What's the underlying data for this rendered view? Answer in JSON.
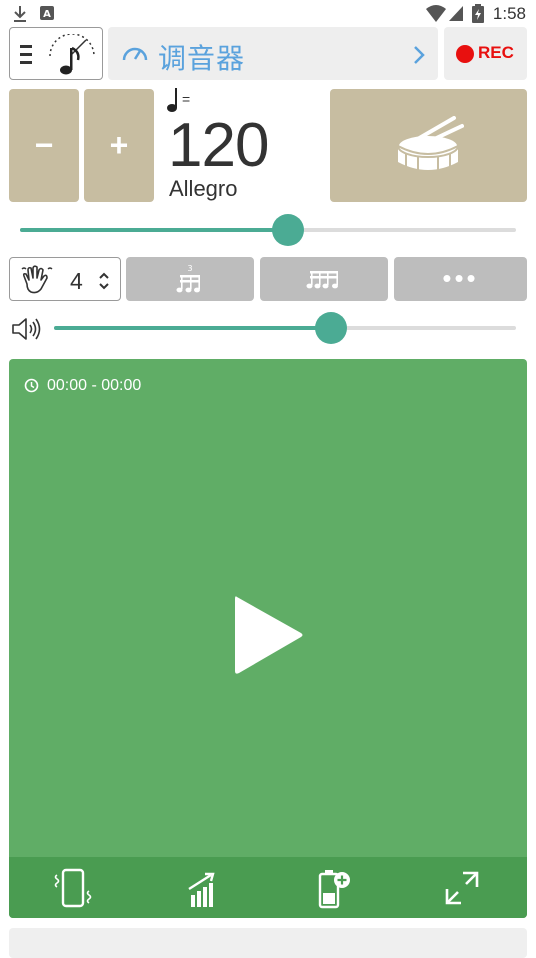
{
  "status_bar": {
    "time": "1:58"
  },
  "header": {
    "menu_icon": "hamburger-menu-icon",
    "metronome_icon": "metronome-note-icon",
    "tuner_label": "调音器",
    "tuner_icon": "gauge-icon",
    "chevron_icon": "chevron-right-icon",
    "rec_label": "REC"
  },
  "tempo": {
    "minus_label": "−",
    "plus_label": "+",
    "equals": "=",
    "bpm": "120",
    "name": "Allegro",
    "drum_icon": "drum-icon",
    "slider_value_fraction": 0.54
  },
  "beats": {
    "hand_icon": "hand-icon",
    "count": "4",
    "triplet_icon": "triplet-note-icon",
    "sixteenth_icon": "sixteenth-notes-icon",
    "more_label": "•••"
  },
  "volume": {
    "speaker_icon": "speaker-icon",
    "slider_value_fraction": 0.6
  },
  "player": {
    "timer_icon": "clock-icon",
    "timer_text": "00:00 - 00:00",
    "play_icon": "play-icon",
    "tools": [
      "vibrate-icon",
      "bar-chart-icon",
      "battery-plus-icon",
      "fullscreen-icon"
    ]
  },
  "colors": {
    "accent": "#4bab94",
    "tan": "#c7bda1",
    "green_panel": "#60ad66",
    "green_toolbar": "#4a9c51",
    "rec_red": "#e8100f",
    "tuner_blue": "#5aa2dd"
  }
}
